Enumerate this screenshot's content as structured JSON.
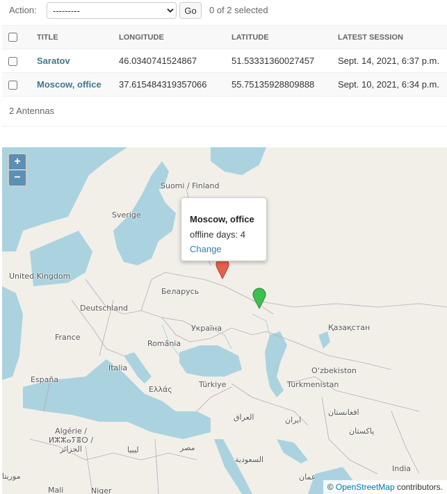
{
  "actions": {
    "label": "Action:",
    "select_value": "---------",
    "go_label": "Go",
    "counter": "0 of 2 selected"
  },
  "table": {
    "headers": [
      "TITLE",
      "LONGITUDE",
      "LATITUDE",
      "LATEST SESSION"
    ],
    "rows": [
      {
        "title": "Saratov",
        "longitude": "46.0340741524867",
        "latitude": "51.53331360027457",
        "session": "Sept. 14, 2021, 6:37 p.m."
      },
      {
        "title": "Moscow, office",
        "longitude": "37.615484319357066",
        "latitude": "55.75135928809888",
        "session": "Sept. 10, 2021, 6:34 p.m."
      }
    ]
  },
  "paginator": "2 Antennas",
  "map": {
    "zoom_in": "+",
    "zoom_out": "−",
    "places": [
      "Suomi / Finland",
      "Sverige",
      "United Kingdom",
      "Беларусь",
      "Deutschland",
      "France",
      "Україна",
      "România",
      "Italia",
      "España",
      "Ελλάς",
      "Türkiye",
      "Қазақстан",
      "O‘zbekiston",
      "Türkmenistan",
      "العراق",
      "ایران",
      "افغانستان",
      "پاکستان",
      "Algérie / ⵍⵣⵣⴰⵢⴻⵔ / الجزائر",
      "ليبيا",
      "مصر",
      "السعودية",
      "India",
      "موريتا",
      "Mali",
      "Niger",
      "عمان"
    ],
    "popup": {
      "title": "Moscow, office",
      "line": "offline days: 4",
      "link": "Change"
    },
    "markers": [
      {
        "name": "Moscow, office",
        "color": "#e8604c"
      },
      {
        "name": "Saratov",
        "color": "#3fbf4f"
      }
    ],
    "attribution_prefix": "© ",
    "attribution_link": "OpenStreetMap",
    "attribution_suffix": " contributors."
  },
  "colors": {
    "link": "#417690",
    "header_bg": "#f8f8f8",
    "water": "#aad3df",
    "land": "#f2efe9",
    "zoom": "#5b8fb3"
  }
}
